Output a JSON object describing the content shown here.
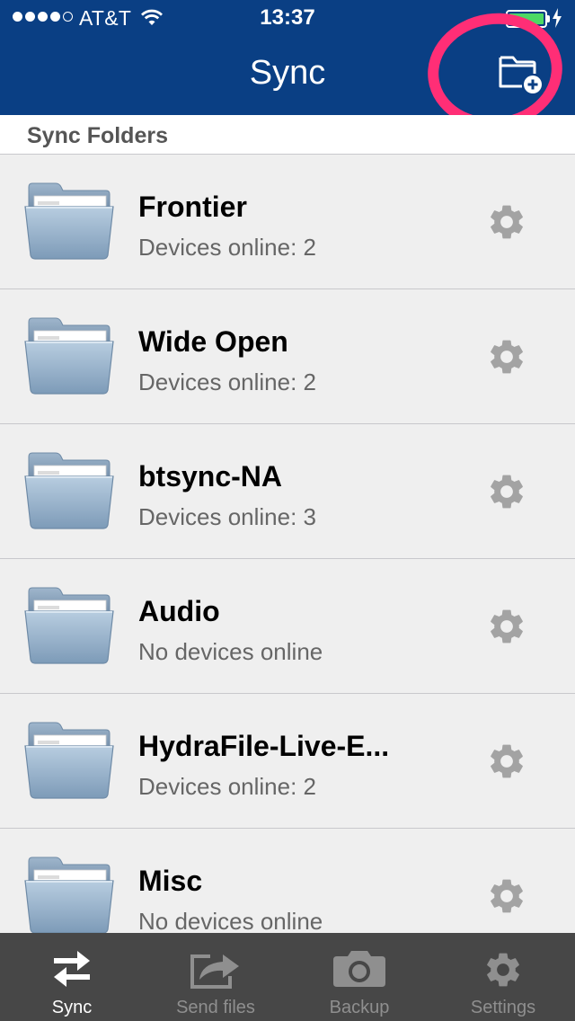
{
  "status_bar": {
    "carrier": "AT&T",
    "time": "13:37",
    "signal_bars_filled": 4,
    "signal_bars_total": 5,
    "battery_level": 1.0,
    "charging": true
  },
  "header": {
    "title": "Sync",
    "add_folder_icon": "folder-plus-icon",
    "annotation_color": "#ff2e76"
  },
  "section": {
    "title": "Sync Folders"
  },
  "folders": [
    {
      "name": "Frontier",
      "status": "Devices online: 2"
    },
    {
      "name": "Wide Open",
      "status": "Devices online: 2"
    },
    {
      "name": "btsync-NA",
      "status": "Devices online: 3"
    },
    {
      "name": "Audio",
      "status": "No devices online"
    },
    {
      "name": "HydraFile-Live-E...",
      "status": "Devices online: 2"
    },
    {
      "name": "Misc",
      "status": "No devices online"
    }
  ],
  "tabs": [
    {
      "label": "Sync",
      "icon": "sync-arrows-icon",
      "active": true
    },
    {
      "label": "Send files",
      "icon": "share-arrow-icon",
      "active": false
    },
    {
      "label": "Backup",
      "icon": "camera-icon",
      "active": false
    },
    {
      "label": "Settings",
      "icon": "gear-icon",
      "active": false
    }
  ],
  "colors": {
    "header_bg": "#0a3f84",
    "tabbar_bg": "#474747",
    "list_bg": "#efefef",
    "battery_fill": "#4cd964"
  }
}
